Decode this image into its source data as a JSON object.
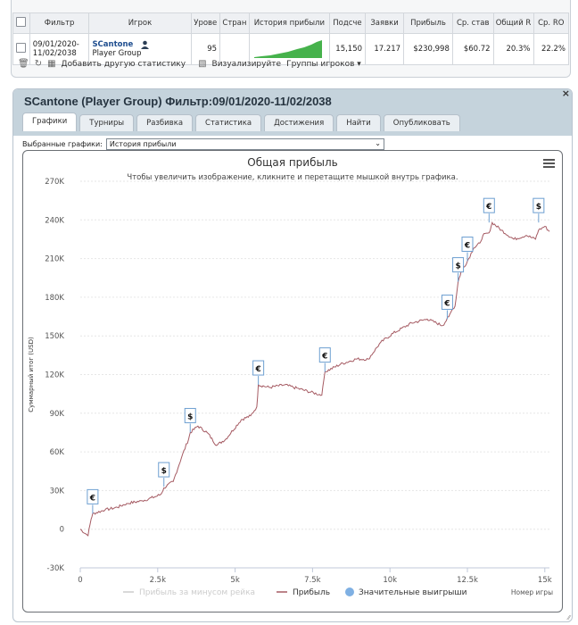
{
  "table": {
    "headers": [
      "Фильтр",
      "Игрок",
      "Уровень",
      "Страна",
      "История прибыли",
      "Подсчет",
      "Заявки",
      "Прибыль",
      "Ср. ставка",
      "Общий ROI",
      "Ср. ROI"
    ],
    "headers_visible": [
      "Фильтр",
      "Игрок",
      "Урове",
      "Стран",
      "История прибыли",
      "Подсче",
      "Заявки",
      "Прибыль",
      "Ср. став",
      "Общий R",
      "Ср. RO"
    ],
    "row": {
      "filter": "09/01/2020-\n11/02/2038",
      "player_name": "SCantone",
      "player_group": "Player Group",
      "level": "95",
      "country": "",
      "count": "15,150",
      "entries": "17.217",
      "profit": "$230,998",
      "avg_stake": "$60.72",
      "total_roi": "20.3%",
      "avg_roi": "22.2%"
    }
  },
  "toolbar": {
    "add_stats": "Добавить другую статистику",
    "visualize": "Визуализируйте",
    "player_groups": "Группы игроков"
  },
  "panel": {
    "title": "SCantone (Player Group) Фильтр:09/01/2020-11/02/2038",
    "tabs": [
      "Графики",
      "Турниры",
      "Разбивка",
      "Статистика",
      "Достижения",
      "Найти",
      "Опубликовать"
    ],
    "selected_label": "Выбранные графики:",
    "selected_value": "История прибыли"
  },
  "chart_data": {
    "type": "line",
    "title": "Общая прибыль",
    "subtitle": "Чтобы увеличить изображение, кликните и перетащите мышкой внутрь графика.",
    "xlabel": "Номер игры",
    "ylabel": "Суммарный итог (USD)",
    "xlim": [
      0,
      15150
    ],
    "ylim": [
      -30000,
      270000
    ],
    "x_ticks": [
      0,
      2500,
      5000,
      7500,
      10000,
      12500,
      15000
    ],
    "x_tick_labels": [
      "0",
      "2.5k",
      "5k",
      "7.5k",
      "10k",
      "12.5k",
      "15k"
    ],
    "y_ticks": [
      -30000,
      0,
      30000,
      60000,
      90000,
      120000,
      150000,
      180000,
      210000,
      240000,
      270000
    ],
    "y_tick_labels": [
      "-30K",
      "0",
      "30K",
      "60K",
      "90K",
      "120K",
      "150K",
      "180K",
      "210K",
      "240K",
      "270K"
    ],
    "legend": [
      "Прибыль за минусом рейка",
      "Прибыль",
      "Значительные выигрыши"
    ],
    "series": [
      {
        "name": "Прибыль",
        "color": "#a55a62",
        "x": [
          0,
          250,
          350,
          400,
          800,
          1200,
          1500,
          2000,
          2400,
          2600,
          2700,
          3000,
          3300,
          3500,
          3550,
          3800,
          4100,
          4400,
          4700,
          5200,
          5500,
          5700,
          5750,
          6100,
          6600,
          7200,
          7800,
          7900,
          8400,
          8900,
          9300,
          9700,
          10100,
          10700,
          11200,
          11700,
          11900,
          12000,
          12100,
          12200,
          12300,
          12500,
          12700,
          12900,
          13000,
          13200,
          13300,
          13600,
          14000,
          14400,
          14700,
          14800,
          15000,
          15150
        ],
        "y": [
          0,
          -5000,
          8000,
          12000,
          15000,
          17000,
          20000,
          22000,
          25000,
          27000,
          32000,
          37000,
          58000,
          70000,
          75000,
          80000,
          75000,
          65000,
          70000,
          85000,
          88000,
          95000,
          112000,
          110000,
          112000,
          108000,
          104000,
          122000,
          128000,
          132000,
          132000,
          145000,
          152000,
          160000,
          163000,
          158000,
          165000,
          170000,
          173000,
          192000,
          200000,
          208000,
          218000,
          222000,
          228000,
          230000,
          238000,
          232000,
          225000,
          228000,
          225000,
          232000,
          235000,
          231000
        ]
      },
      {
        "name": "Прибыль за минусом рейка",
        "color": "#d0d0d0",
        "x": [],
        "y": []
      }
    ],
    "significant_wins": [
      {
        "x": 400,
        "y": 12000,
        "symbol": "€"
      },
      {
        "x": 2700,
        "y": 33000,
        "symbol": "$"
      },
      {
        "x": 3550,
        "y": 75000,
        "symbol": "$"
      },
      {
        "x": 5750,
        "y": 112000,
        "symbol": "€"
      },
      {
        "x": 7900,
        "y": 122000,
        "symbol": "€"
      },
      {
        "x": 11850,
        "y": 163000,
        "symbol": "€"
      },
      {
        "x": 12200,
        "y": 192000,
        "symbol": "$"
      },
      {
        "x": 12500,
        "y": 208000,
        "symbol": "€"
      },
      {
        "x": 13200,
        "y": 238000,
        "symbol": "€"
      },
      {
        "x": 14800,
        "y": 238000,
        "symbol": "$"
      }
    ]
  }
}
